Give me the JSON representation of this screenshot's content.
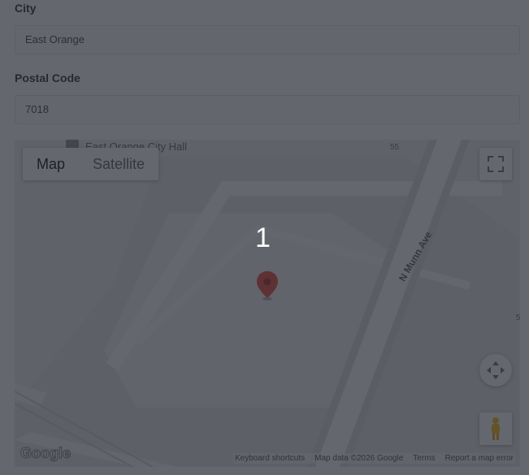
{
  "form": {
    "city_label": "City",
    "city_value": "East Orange",
    "postal_label": "Postal Code",
    "postal_value": "7018"
  },
  "map": {
    "poi_label": "East Orange City Hall",
    "street_label": "N Munn Ave",
    "route_number": "55",
    "route_number_edge": "5",
    "map_type": {
      "options": [
        "Map",
        "Satellite"
      ],
      "selected": "Map"
    },
    "attribution": {
      "keyboard": "Keyboard shortcuts",
      "data": "Map data ©2026 Google",
      "terms": "Terms",
      "report": "Report a map error"
    },
    "logo": "Google",
    "marker_color": "#ea4335"
  },
  "overlay": {
    "step_number": "1",
    "color": "#282c34"
  }
}
